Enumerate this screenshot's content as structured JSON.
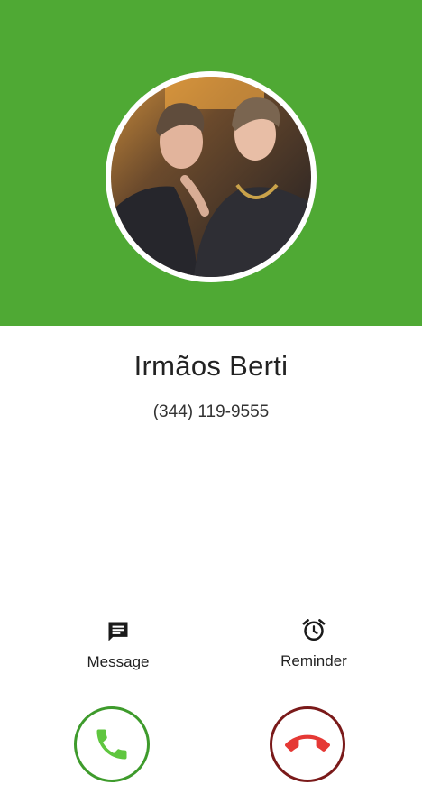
{
  "colors": {
    "header_background": "#4fa934",
    "accept": "#3e9b2c",
    "accept_icon": "#5fc63f",
    "decline": "#7a1a1a",
    "decline_icon": "#e53935"
  },
  "caller": {
    "name": "Irmãos Berti",
    "number": "(344) 119-9555",
    "photo_icon": "contact-photo"
  },
  "actions": {
    "message": {
      "label": "Message",
      "icon": "message-icon"
    },
    "reminder": {
      "label": "Reminder",
      "icon": "alarm-clock-icon"
    }
  },
  "call_controls": {
    "accept_icon": "phone-icon",
    "decline_icon": "phone-hangup-icon"
  }
}
